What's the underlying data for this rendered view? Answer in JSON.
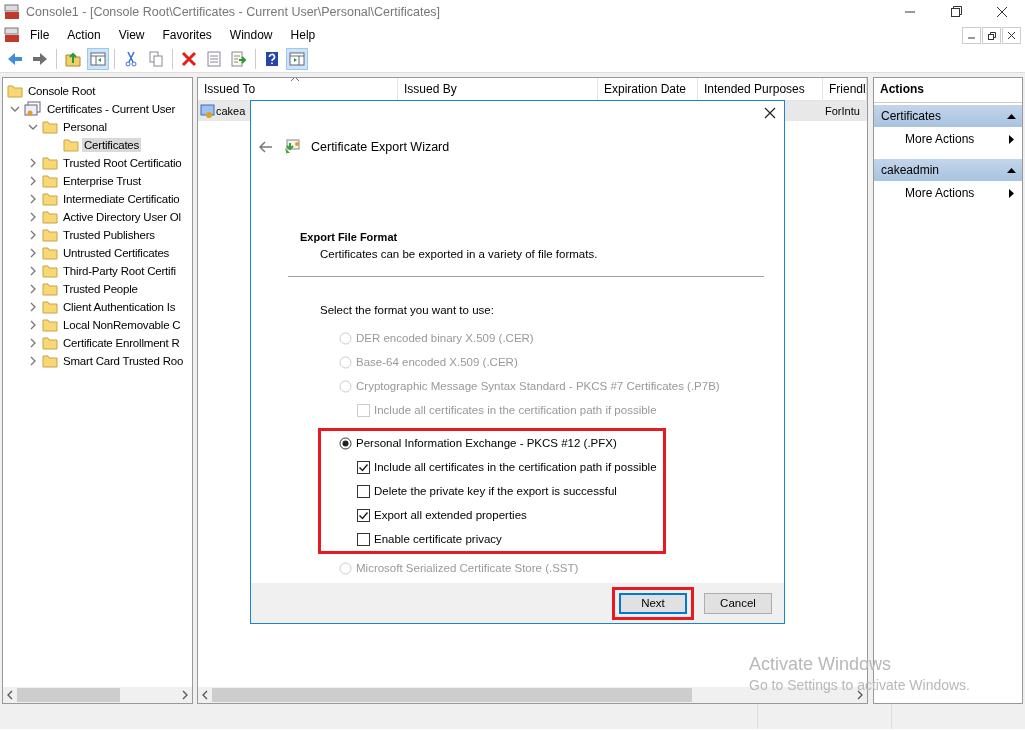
{
  "window": {
    "title": "Console1 - [Console Root\\Certificates - Current User\\Personal\\Certificates]"
  },
  "menu": [
    "File",
    "Action",
    "View",
    "Favorites",
    "Window",
    "Help"
  ],
  "toolbar": [
    {
      "kind": "back",
      "pressed": false
    },
    {
      "kind": "forward",
      "pressed": false
    },
    {
      "kind": "sep"
    },
    {
      "kind": "up",
      "pressed": false
    },
    {
      "kind": "tree",
      "pressed": true
    },
    {
      "kind": "sep"
    },
    {
      "kind": "cut",
      "pressed": false
    },
    {
      "kind": "copy",
      "pressed": false
    },
    {
      "kind": "sep"
    },
    {
      "kind": "delete",
      "pressed": false
    },
    {
      "kind": "properties",
      "pressed": false
    },
    {
      "kind": "export",
      "pressed": false
    },
    {
      "kind": "sep"
    },
    {
      "kind": "help",
      "pressed": false
    },
    {
      "kind": "actionpane",
      "pressed": true
    }
  ],
  "tree": [
    {
      "label": "Console Root",
      "selected": false,
      "children": [
        {
          "label": "Certificates - Current User",
          "kind": "store",
          "expanded": true,
          "selected": false,
          "children": [
            {
              "label": "Personal",
              "expanded": true,
              "selected": false,
              "children": [
                {
                  "label": "Certificates",
                  "selected": true
                }
              ]
            },
            {
              "label": "Trusted Root Certificatio",
              "expanded": false,
              "selected": false
            },
            {
              "label": "Enterprise Trust",
              "expanded": false,
              "selected": false
            },
            {
              "label": "Intermediate Certificatio",
              "expanded": false,
              "selected": false
            },
            {
              "label": "Active Directory User Ol",
              "expanded": false,
              "selected": false
            },
            {
              "label": "Trusted Publishers",
              "expanded": false,
              "selected": false
            },
            {
              "label": "Untrusted Certificates",
              "expanded": false,
              "selected": false
            },
            {
              "label": "Third-Party Root Certifi",
              "expanded": false,
              "selected": false
            },
            {
              "label": "Trusted People",
              "expanded": false,
              "selected": false
            },
            {
              "label": "Client Authentication Is",
              "expanded": false,
              "selected": false
            },
            {
              "label": "Local NonRemovable C",
              "expanded": false,
              "selected": false
            },
            {
              "label": "Certificate Enrollment R",
              "expanded": false,
              "selected": false
            },
            {
              "label": "Smart Card Trusted Roo",
              "expanded": false,
              "selected": false
            }
          ]
        }
      ]
    }
  ],
  "table": {
    "columns": [
      {
        "label": "Issued To",
        "sorted": true
      },
      {
        "label": "Issued By",
        "sorted": false
      },
      {
        "label": "Expiration Date",
        "sorted": false
      },
      {
        "label": "Intended Purposes",
        "sorted": false
      },
      {
        "label": "Friendl",
        "sorted": false
      }
    ],
    "rows": [
      {
        "issued_to": "cakea",
        "friendly_name": "ForIntu"
      }
    ]
  },
  "actions": {
    "title": "Actions",
    "groups": [
      {
        "title": "Certificates",
        "items": [
          "More Actions"
        ]
      },
      {
        "title": "cakeadmin",
        "items": [
          "More Actions"
        ]
      }
    ]
  },
  "dialog": {
    "title": "Certificate Export Wizard",
    "heading": "Export File Format",
    "description": "Certificates can be exported in a variety of file formats.",
    "prompt": "Select the format you want to use:",
    "options": [
      {
        "label": "DER encoded binary X.509 (.CER)",
        "selected": false,
        "disabled": true,
        "highlighted": false
      },
      {
        "label": "Base-64 encoded X.509 (.CER)",
        "selected": false,
        "disabled": true,
        "highlighted": false
      },
      {
        "label": "Cryptographic Message Syntax Standard - PKCS #7 Certificates (.P7B)",
        "selected": false,
        "disabled": true,
        "highlighted": false,
        "children": [
          {
            "label": "Include all certificates in the certification path if possible",
            "checked": false,
            "disabled": true
          }
        ]
      },
      {
        "label": "Personal Information Exchange - PKCS #12 (.PFX)",
        "selected": true,
        "disabled": false,
        "highlighted": true,
        "children": [
          {
            "label": "Include all certificates in the certification path if possible",
            "checked": true,
            "disabled": false
          },
          {
            "label": "Delete the private key if the export is successful",
            "checked": false,
            "disabled": false
          },
          {
            "label": "Export all extended properties",
            "checked": true,
            "disabled": false
          },
          {
            "label": "Enable certificate privacy",
            "checked": false,
            "disabled": false
          }
        ]
      },
      {
        "label": "Microsoft Serialized Certificate Store (.SST)",
        "selected": false,
        "disabled": true,
        "highlighted": false
      }
    ],
    "buttons": [
      {
        "label": "Next",
        "default": true,
        "highlighted": true
      },
      {
        "label": "Cancel",
        "default": false,
        "highlighted": false
      }
    ]
  },
  "activation": {
    "title": "Activate Windows",
    "message": "Go to Settings to activate Windows."
  }
}
